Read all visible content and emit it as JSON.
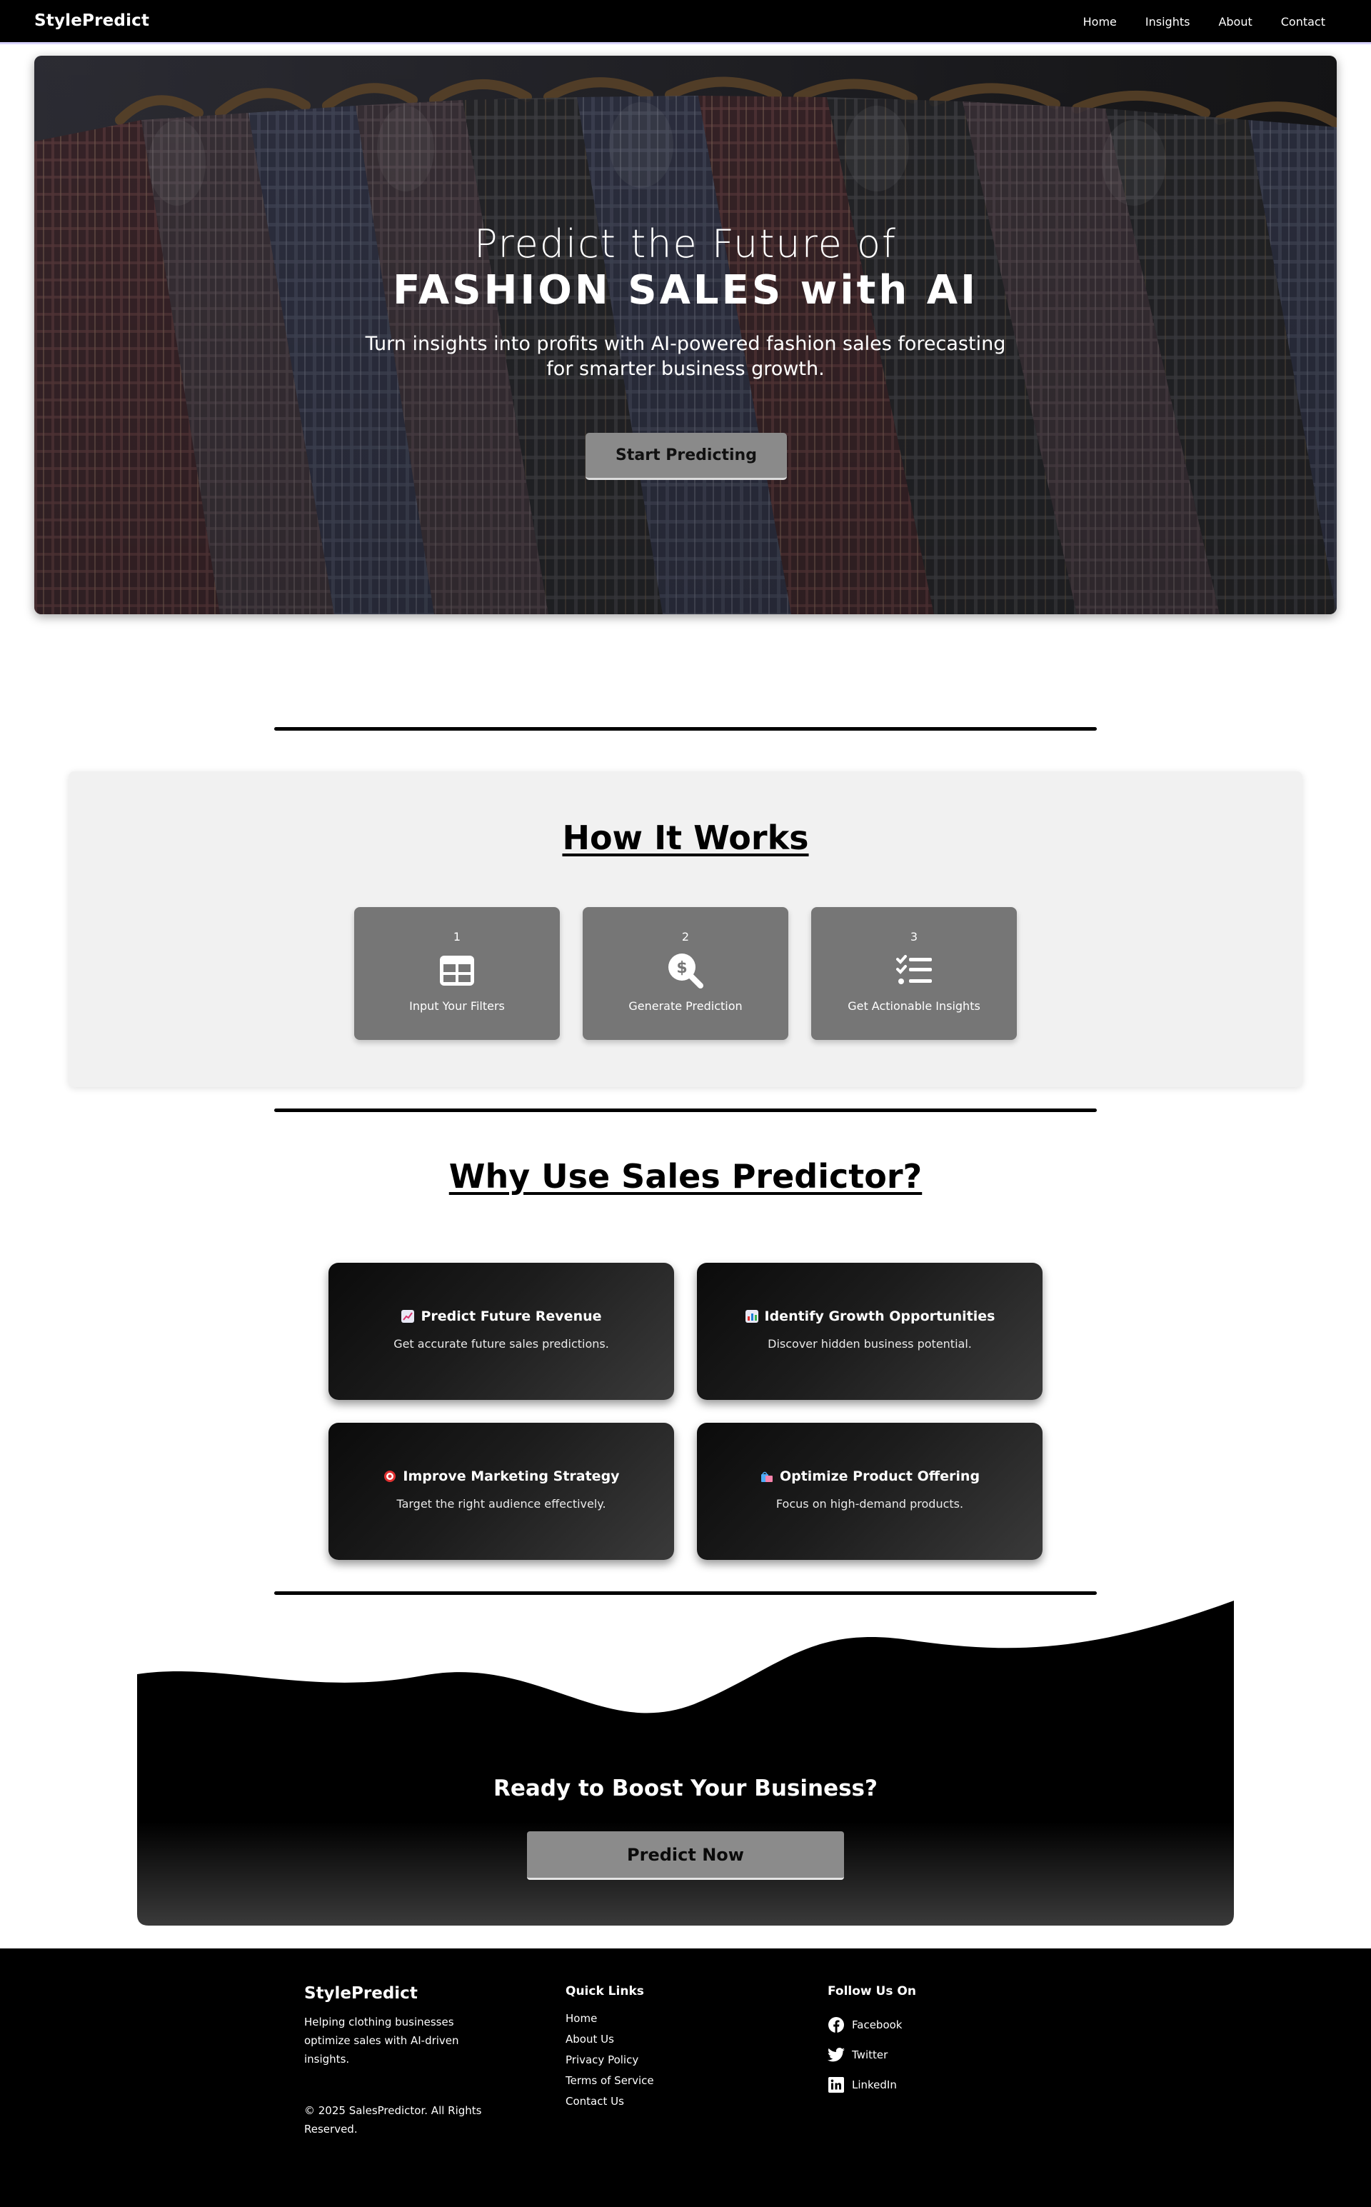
{
  "nav": {
    "brand": "StylePredict",
    "links": [
      "Home",
      "Insights",
      "About",
      "Contact"
    ]
  },
  "hero": {
    "line1": "Predict the Future of",
    "line2": "FASHION SALES with AI",
    "subtitle": "Turn insights into profits with AI-powered fashion sales forecasting for smarter business growth.",
    "button": "Start Predicting"
  },
  "how_it_works": {
    "title": "How It Works",
    "steps": [
      {
        "number": "1",
        "icon": "table-grid-icon",
        "label": "Input Your Filters"
      },
      {
        "number": "2",
        "icon": "search-dollar-icon",
        "label": "Generate Prediction"
      },
      {
        "number": "3",
        "icon": "checklist-icon",
        "label": "Get Actionable Insights"
      }
    ]
  },
  "why": {
    "title": "Why Use Sales Predictor?",
    "features": [
      {
        "icon": "chart-up-emoji",
        "title": "Predict Future Revenue",
        "desc": "Get accurate future sales predictions."
      },
      {
        "icon": "bar-chart-emoji",
        "title": "Identify Growth Opportunities",
        "desc": "Discover hidden business potential."
      },
      {
        "icon": "target-emoji",
        "title": "Improve Marketing Strategy",
        "desc": "Target the right audience effectively."
      },
      {
        "icon": "shopping-bags-emoji",
        "title": "Optimize Product Offering",
        "desc": "Focus on high-demand products."
      }
    ]
  },
  "cta": {
    "title": "Ready to Boost Your Business?",
    "button": "Predict Now"
  },
  "footer": {
    "brand": "StylePredict",
    "about": "Helping clothing businesses optimize sales with AI-driven insights.",
    "copyright": "© 2025 SalesPredictor. All Rights Reserved.",
    "quick_links_title": "Quick Links",
    "quick_links": [
      "Home",
      "About Us",
      "Privacy Policy",
      "Terms of Service",
      "Contact Us"
    ],
    "follow_title": "Follow Us On",
    "social": [
      {
        "icon": "facebook-icon",
        "label": "Facebook"
      },
      {
        "icon": "twitter-icon",
        "label": "Twitter"
      },
      {
        "icon": "linkedin-icon",
        "label": "LinkedIn"
      }
    ]
  },
  "colors": {
    "nav_bg": "#000000",
    "nav_border": "#d9d4ff",
    "step_card": "#767676",
    "section_bg": "#f1f1f1",
    "button_gray": "#8a8a8a"
  }
}
